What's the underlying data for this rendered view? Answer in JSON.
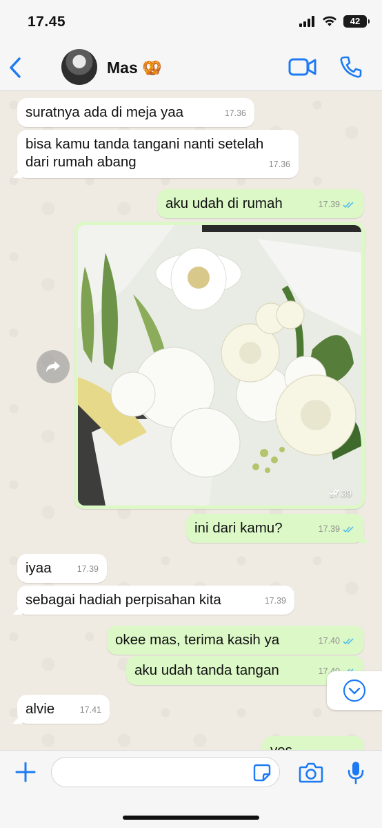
{
  "status_bar": {
    "time": "17.45",
    "battery": "42"
  },
  "header": {
    "contact_name": "Mas 🥨"
  },
  "messages": [
    {
      "text": "suratnya ada di meja yaa",
      "time": "17.36"
    },
    {
      "text": "bisa kamu tanda tangani nanti setelah\ndari rumah abang",
      "time": "17.36"
    },
    {
      "text": "aku udah di rumah",
      "time": "17.39"
    },
    {
      "photo_time": "17.39"
    },
    {
      "text": "ini dari kamu?",
      "time": "17.39"
    },
    {
      "text": "iyaa",
      "time": "17.39"
    },
    {
      "text": "sebagai hadiah perpisahan kita",
      "time": "17.39"
    },
    {
      "text": "okee mas, terima kasih ya",
      "time": "17.40"
    },
    {
      "text": "aku udah tanda tangan",
      "time": "17.40"
    },
    {
      "text": "alvie",
      "time": "17.41"
    },
    {
      "text": "yes",
      "time": ""
    }
  ],
  "input": {
    "value": "",
    "placeholder": ""
  },
  "colors": {
    "accent": "#1d7af2",
    "outgoing_bubble": "#dbf8c6",
    "incoming_bubble": "#ffffff",
    "read_ticks": "#53bdeb"
  }
}
